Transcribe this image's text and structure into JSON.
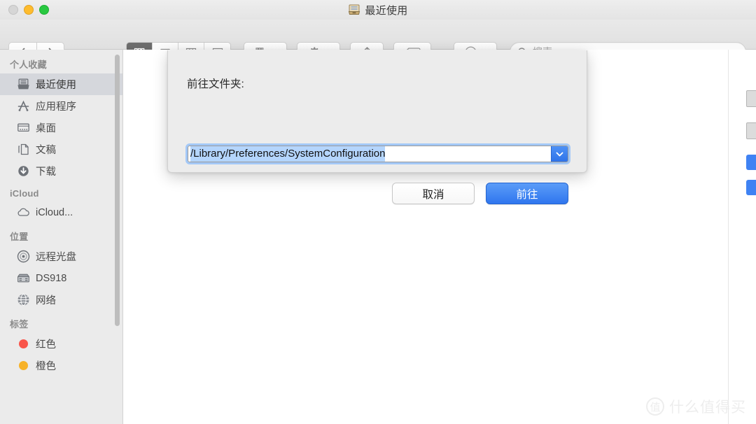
{
  "window": {
    "title": "最近使用",
    "title_icon": "recents-drawer-icon",
    "traffic_lights": [
      "close-button",
      "minimize-button",
      "maximize-button"
    ]
  },
  "toolbar": {
    "back_label": "‹",
    "forward_label": "›",
    "view_modes": [
      {
        "name": "icon-view",
        "icon": "grid-icon",
        "active": true
      },
      {
        "name": "list-view",
        "icon": "list-icon",
        "active": false
      },
      {
        "name": "column-view",
        "icon": "columns-icon",
        "active": false
      },
      {
        "name": "gallery-view",
        "icon": "gallery-icon",
        "active": false
      }
    ],
    "arrange_button": "arrange-group-icon",
    "action_button": "gear-icon",
    "share_button": "share-icon",
    "tag_button": "tag-icon",
    "airdrop_button": "registered-icon"
  },
  "search": {
    "placeholder": "搜索",
    "value": "",
    "icon": "search-icon"
  },
  "sidebar": {
    "sections": [
      {
        "title": "个人收藏",
        "items": [
          {
            "label": "最近使用",
            "icon": "recents-icon",
            "selected": true
          },
          {
            "label": "应用程序",
            "icon": "applications-icon",
            "selected": false
          },
          {
            "label": "桌面",
            "icon": "desktop-icon",
            "selected": false
          },
          {
            "label": "文稿",
            "icon": "documents-icon",
            "selected": false
          },
          {
            "label": "下载",
            "icon": "downloads-icon",
            "selected": false
          }
        ]
      },
      {
        "title": "iCloud",
        "items": [
          {
            "label": "iCloud...",
            "icon": "cloud-icon",
            "selected": false
          }
        ]
      },
      {
        "title": "位置",
        "items": [
          {
            "label": "远程光盘",
            "icon": "disc-icon",
            "selected": false
          },
          {
            "label": "DS918",
            "icon": "server-icon",
            "selected": false
          },
          {
            "label": "网络",
            "icon": "network-globe-icon",
            "selected": false
          }
        ]
      },
      {
        "title": "标签",
        "items": [
          {
            "label": "红色",
            "icon": "tag-dot-icon",
            "color": "#f9554a",
            "selected": false
          },
          {
            "label": "橙色",
            "icon": "tag-dot-icon",
            "color": "#f7b228",
            "selected": false
          }
        ]
      }
    ]
  },
  "dialog": {
    "name": "go-to-folder-sheet",
    "label": "前往文件夹:",
    "path_value": "/Library/Preferences/SystemConfiguration",
    "path_selected": true,
    "dropdown_icon": "chevron-down-icon",
    "cancel_label": "取消",
    "go_label": "前往"
  },
  "watermark": {
    "logo_char": "值",
    "text": "什么值得买"
  },
  "colors": {
    "accent_blue": "#2f76ee",
    "selection_blue": "#b4d5fd",
    "focus_ring": "#a3c8f7",
    "sidebar_bg": "#ebebeb",
    "dialog_bg": "#ececec",
    "tag_red": "#f9554a",
    "tag_orange": "#f7b228"
  }
}
